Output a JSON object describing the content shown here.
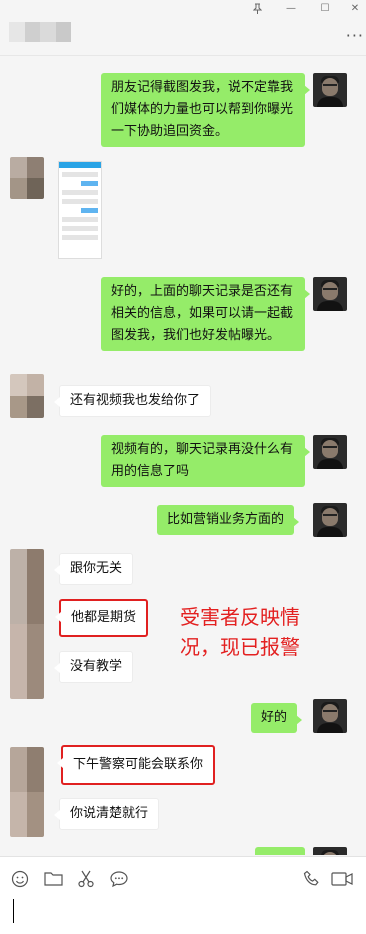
{
  "window": {
    "pin_icon": "pin-icon",
    "min_glyph": "—",
    "max_glyph": "☐",
    "close_glyph": "✕"
  },
  "header": {
    "more_glyph": "···"
  },
  "messages": [
    {
      "side": "right",
      "text": "朋友记得截图发我，说不定靠我们媒体的力量也可以帮到你曝光一下协助追回资金。"
    },
    {
      "side": "left",
      "type": "image"
    },
    {
      "side": "right",
      "text": "好的，上面的聊天记录是否还有相关的信息，如果可以请一起截图发我，我们也好发帖曝光。"
    },
    {
      "side": "left",
      "text": "还有视频我也发给你了"
    },
    {
      "side": "right",
      "text": "视频有的，聊天记录再没什么有用的信息了吗"
    },
    {
      "side": "right",
      "text": "比如营销业务方面的"
    },
    {
      "side": "left",
      "text": "跟你无关"
    },
    {
      "side": "left",
      "text": "他都是期货",
      "highlight": true
    },
    {
      "side": "left",
      "text": "没有教学"
    },
    {
      "side": "right",
      "text": "好的"
    },
    {
      "side": "left",
      "text": "下午警察可能会联系你",
      "highlight": true
    },
    {
      "side": "left",
      "text": "你说清楚就行"
    }
  ],
  "annotation": "受害者反映情况，现已报警",
  "toolbar": {
    "emoji_icon": "emoji-icon",
    "folder_icon": "folder-icon",
    "scissors_icon": "scissors-icon",
    "chat_icon": "chat-bubble-icon",
    "phone_icon": "phone-icon",
    "video_icon": "video-call-icon"
  },
  "colors": {
    "self_bubble": "#95ec69",
    "other_bubble": "#ffffff",
    "highlight": "#e02020",
    "annotation": "#e32020"
  }
}
